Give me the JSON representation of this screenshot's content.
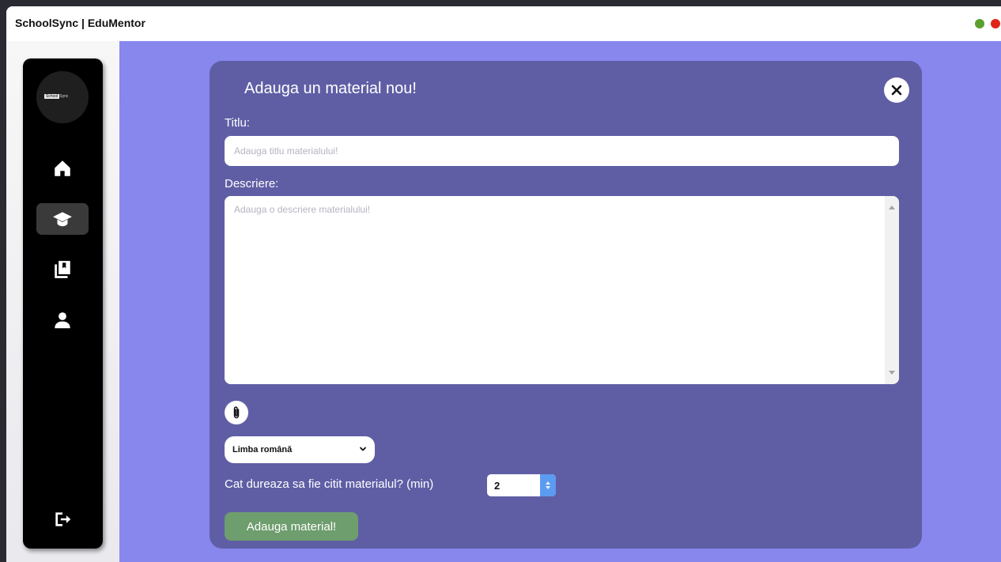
{
  "app": {
    "title": "SchoolSync | EduMentor"
  },
  "sidebar": {
    "logo_text_highlight": "School",
    "logo_text_rest": "Sync",
    "items": [
      {
        "icon": "home-icon",
        "active": false
      },
      {
        "icon": "graduation-cap-icon",
        "active": true
      },
      {
        "icon": "book-icon",
        "active": false
      },
      {
        "icon": "user-icon",
        "active": false
      }
    ],
    "logout_icon": "logout-icon"
  },
  "modal": {
    "title": "Adauga un material nou!",
    "title_label": "Titlu:",
    "title_placeholder": "Adauga titlu materialului!",
    "title_value": "",
    "description_label": "Descriere:",
    "description_placeholder": "Adauga o descriere materialului!",
    "description_value": "",
    "language_selected": "Limba română",
    "duration_label": "Cat dureaza sa fie citit materialul? (min)",
    "duration_value": "2",
    "submit_label": "Adauga material!"
  },
  "colors": {
    "content_background": "#8787ee",
    "modal_background": "#5f5ea5",
    "sidebar_background": "#000000",
    "submit_button": "#6e9d6e",
    "stepper_accent": "#5b9bf0"
  }
}
